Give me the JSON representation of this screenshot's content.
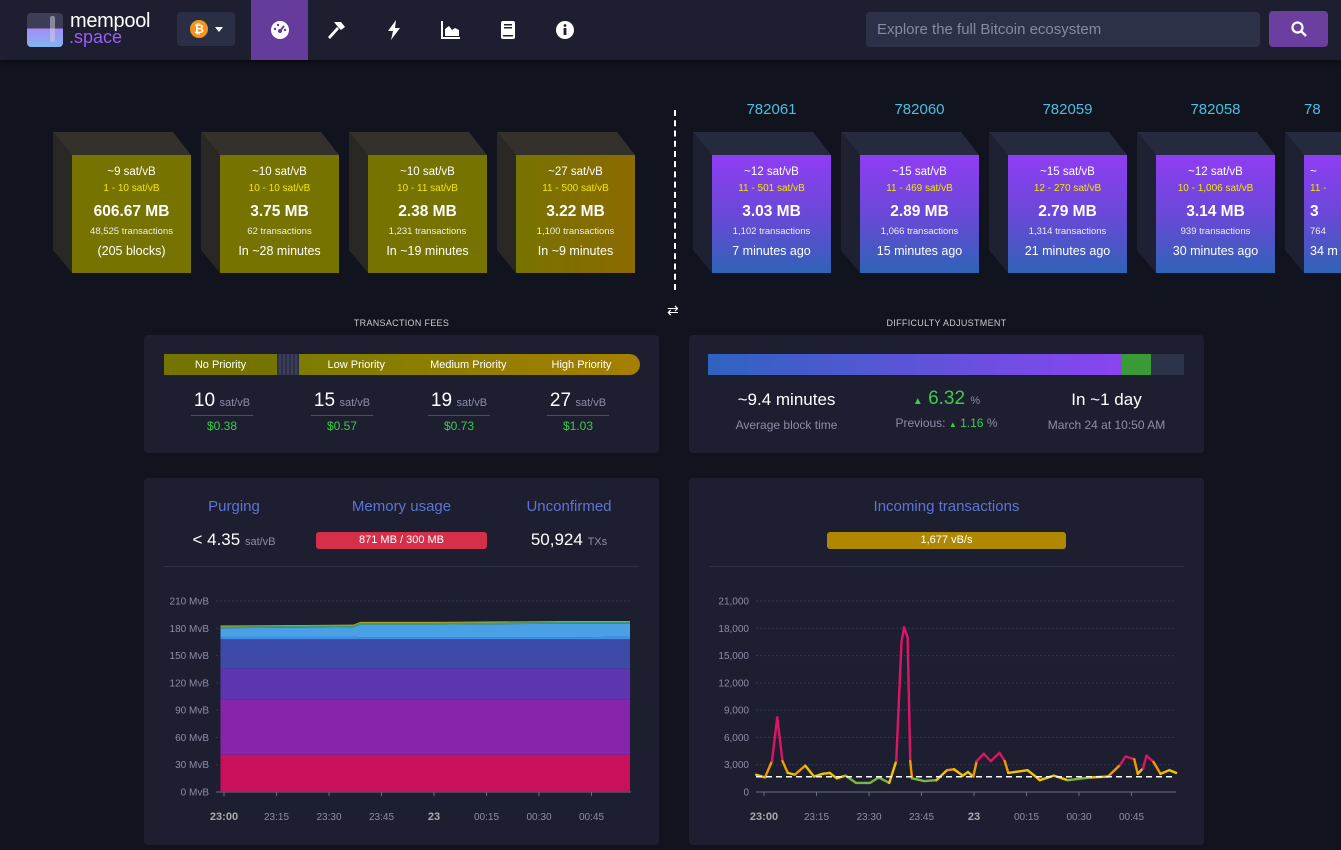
{
  "header": {
    "logo_line1": "mempool",
    "logo_line2": ".space",
    "network_icon": "bitcoin-icon",
    "nav": [
      {
        "name": "dashboard-icon",
        "active": true
      },
      {
        "name": "mining-hammer-icon"
      },
      {
        "name": "lightning-icon"
      },
      {
        "name": "graphs-icon"
      },
      {
        "name": "docs-book-icon"
      },
      {
        "name": "about-info-icon"
      }
    ],
    "search_placeholder": "Explore the full Bitcoin ecosystem",
    "search_icon": "search-icon"
  },
  "mempool_blocks": [
    {
      "median": "~9 sat/vB",
      "range": "1 - 10 sat/vB",
      "size": "606.67 MB",
      "txs": "48,525 transactions",
      "eta": "(205 blocks)"
    },
    {
      "median": "~10 sat/vB",
      "range": "10 - 10 sat/vB",
      "size": "3.75 MB",
      "txs": "62 transactions",
      "eta": "In ~28 minutes"
    },
    {
      "median": "~10 sat/vB",
      "range": "10 - 11 sat/vB",
      "size": "2.38 MB",
      "txs": "1,231 transactions",
      "eta": "In ~19 minutes"
    },
    {
      "median": "~27 sat/vB",
      "range": "11 - 500 sat/vB",
      "size": "3.22 MB",
      "txs": "1,100 transactions",
      "eta": "In ~9 minutes"
    }
  ],
  "blockchain_blocks": [
    {
      "height": "782061",
      "median": "~12 sat/vB",
      "range": "11 - 501 sat/vB",
      "size": "3.03 MB",
      "txs": "1,102 transactions",
      "age": "7 minutes ago"
    },
    {
      "height": "782060",
      "median": "~15 sat/vB",
      "range": "11 - 469 sat/vB",
      "size": "2.89 MB",
      "txs": "1,066 transactions",
      "age": "15 minutes ago"
    },
    {
      "height": "782059",
      "median": "~15 sat/vB",
      "range": "12 - 270 sat/vB",
      "size": "2.79 MB",
      "txs": "1,314 transactions",
      "age": "21 minutes ago"
    },
    {
      "height": "782058",
      "median": "~12 sat/vB",
      "range": "10 - 1,006 sat/vB",
      "size": "3.14 MB",
      "txs": "939 transactions",
      "age": "30 minutes ago"
    },
    {
      "height": "78",
      "median": "~",
      "range": "11 -",
      "size": "3",
      "txs": "764",
      "age": "34 m"
    }
  ],
  "fees": {
    "section_title": "TRANSACTION FEES",
    "labels": [
      "No Priority",
      "Low Priority",
      "Medium Priority",
      "High Priority"
    ],
    "values": [
      "10",
      "15",
      "19",
      "27"
    ],
    "unit": "sat/vB",
    "usd": [
      "$0.38",
      "$0.57",
      "$0.73",
      "$1.03"
    ]
  },
  "difficulty": {
    "section_title": "DIFFICULTY ADJUSTMENT",
    "progress_pct": 87,
    "green_pct": 6,
    "avg_block_time": "~9.4 minutes",
    "avg_block_time_label": "Average block time",
    "change": "6.32",
    "change_unit": "%",
    "previous_label": "Previous:",
    "previous": "1.16",
    "previous_unit": "%",
    "eta": "In ~1 day",
    "eta_date": "March 24 at 10:50 AM",
    "up_color": "#3bcc49"
  },
  "mempool_stats": {
    "purging_label": "Purging",
    "purging_value": "< 4.35",
    "purging_unit": "sat/vB",
    "memory_label": "Memory usage",
    "memory_value": "871 MB / 300 MB",
    "unconfirmed_label": "Unconfirmed",
    "unconfirmed_value": "50,924",
    "unconfirmed_unit": "TXs"
  },
  "incoming": {
    "title": "Incoming transactions",
    "rate": "1,677 vB/s"
  },
  "chart_data": [
    {
      "type": "area",
      "stacked": true,
      "ylim": [
        0,
        210
      ],
      "yticks": [
        "0 MvB",
        "30 MvB",
        "60 MvB",
        "90 MvB",
        "120 MvB",
        "150 MvB",
        "180 MvB",
        "210 MvB"
      ],
      "xticks": [
        "23:00",
        "23:15",
        "23:30",
        "23:45",
        "23",
        "00:15",
        "00:30",
        "00:45"
      ],
      "x": [
        "22:59",
        "23:37",
        "23:39",
        "00:00",
        "00:40",
        "00:56"
      ],
      "series": [
        {
          "color": "#c9105b",
          "values": [
            41,
            41,
            41,
            41,
            41,
            41
          ]
        },
        {
          "color": "#8624ac",
          "values": [
            61,
            61,
            61,
            61,
            61,
            61
          ]
        },
        {
          "color": "#5c36b1",
          "values": [
            34,
            34,
            34,
            34,
            34,
            34
          ]
        },
        {
          "color": "#3e4aa8",
          "values": [
            32,
            32,
            32,
            32,
            32,
            32
          ]
        },
        {
          "color": "#3f8fe6",
          "values": [
            3,
            3,
            2,
            2,
            2,
            3
          ]
        },
        {
          "color": "#4aa0e4",
          "values": [
            9,
            10,
            14,
            14,
            15,
            14
          ]
        },
        {
          "color": "#3aa06a",
          "values": [
            2,
            2,
            2,
            2,
            2,
            2
          ]
        },
        {
          "color": "#c0b020",
          "values": [
            1,
            1,
            1,
            1,
            1,
            1
          ]
        }
      ]
    },
    {
      "type": "line",
      "ylim": [
        0,
        21000
      ],
      "yticks": [
        "0",
        "3,000",
        "6,000",
        "9,000",
        "12,000",
        "15,000",
        "18,000",
        "21,000"
      ],
      "xticks": [
        "23:00",
        "23:15",
        "23:30",
        "23:45",
        "23",
        "00:15",
        "00:30",
        "00:45"
      ],
      "threshold": 1677,
      "x": [
        "22:57:30",
        "23:00",
        "23:02",
        "23:03:30",
        "23:05",
        "23:06:30",
        "23:08:30",
        "23:11:30",
        "23:14",
        "23:16:30",
        "23:18:30",
        "23:20:30",
        "23:23",
        "23:26",
        "23:30",
        "23:32:30",
        "23:35:30",
        "23:37:30",
        "23:39",
        "23:39:45",
        "23:40:45",
        "23:41:30",
        "23:42",
        "23:45:30",
        "23:49",
        "23:52",
        "23:54",
        "23:56:30",
        "23:58",
        "23:59:30",
        "00:00:30",
        "00:02:30",
        "00:04:30",
        "00:07",
        "00:08:30",
        "00:09:30",
        "00:15",
        "00:17",
        "00:18:30",
        "00:22:30",
        "00:26:30",
        "00:33",
        "00:38",
        "00:41:30",
        "00:43",
        "00:45:30",
        "00:46:30",
        "00:48",
        "00:49",
        "00:51",
        "00:53",
        "00:55:30",
        "00:57:30"
      ],
      "values": [
        1900,
        1600,
        3400,
        8200,
        3400,
        2100,
        1900,
        2900,
        1700,
        2000,
        2100,
        1500,
        1800,
        1000,
        1000,
        1600,
        1000,
        3400,
        16500,
        18100,
        17000,
        3400,
        1500,
        1200,
        1300,
        2400,
        2500,
        1800,
        2200,
        1700,
        3400,
        4200,
        3400,
        4300,
        3400,
        2100,
        2400,
        1800,
        1300,
        1800,
        1300,
        1600,
        1700,
        3000,
        3900,
        3600,
        2000,
        2600,
        4000,
        3300,
        2000,
        2400,
        2100
      ]
    }
  ]
}
